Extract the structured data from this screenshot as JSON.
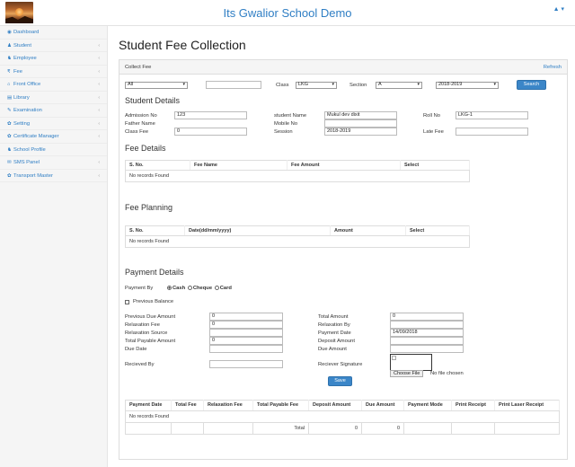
{
  "header": {
    "title": "Its Gwalior School Demo",
    "user_menu": "▲ ▾"
  },
  "sidebar": {
    "items": [
      {
        "label": "Dashboard",
        "icon": "dashboard-icon",
        "glyph": "◉",
        "has_sub": false
      },
      {
        "label": "Student",
        "icon": "user-icon",
        "glyph": "♟",
        "has_sub": true
      },
      {
        "label": "Employee",
        "icon": "users-icon",
        "glyph": "♞",
        "has_sub": true
      },
      {
        "label": "Fee",
        "icon": "rupee-icon",
        "glyph": "₹",
        "has_sub": true
      },
      {
        "label": "Front Office",
        "icon": "office-icon",
        "glyph": "⌂",
        "has_sub": true
      },
      {
        "label": "Library",
        "icon": "book-icon",
        "glyph": "▤",
        "has_sub": true
      },
      {
        "label": "Examination",
        "icon": "edit-icon",
        "glyph": "✎",
        "has_sub": true
      },
      {
        "label": "Setting",
        "icon": "gear-icon",
        "glyph": "✿",
        "has_sub": true
      },
      {
        "label": "Certificate Manager",
        "icon": "gear-icon",
        "glyph": "✿",
        "has_sub": true
      },
      {
        "label": "School Profile",
        "icon": "users-icon",
        "glyph": "♞",
        "has_sub": false
      },
      {
        "label": "SMS Panel",
        "icon": "mail-icon",
        "glyph": "✉",
        "has_sub": true
      },
      {
        "label": "Transport Master",
        "icon": "gear-icon",
        "glyph": "✿",
        "has_sub": true
      }
    ]
  },
  "page": {
    "title": "Student Fee Collection"
  },
  "panel": {
    "heading": "Collect Fee",
    "refresh": "Refresh"
  },
  "filters": {
    "type_value": "All",
    "search_value": "",
    "class_label": "Class",
    "class_value": "LKG",
    "section_label": "Section",
    "section_value": "A",
    "session_value": "2018-2019",
    "search_button": "Search"
  },
  "student_details": {
    "title": "Student Details",
    "admission_no_label": "Admission No",
    "admission_no": "123",
    "father_name_label": "Father Name",
    "class_fee_label": "Class Fee",
    "class_fee": "0",
    "student_name_label": "student Name",
    "student_name": "Mukul dev dixit",
    "mobile_no_label": "Mobile No",
    "mobile_no": "",
    "session_label": "Session",
    "session": "2018-2019",
    "roll_no_label": "Roll No",
    "roll_no": "LKG-1",
    "late_fee_label": "Late Fee",
    "late_fee": ""
  },
  "fee_details": {
    "title": "Fee Details",
    "columns": [
      "S. No.",
      "Fee Name",
      "Fee Amount",
      "Select"
    ],
    "empty": "No records Found"
  },
  "fee_planning": {
    "title": "Fee Planning",
    "columns": [
      "S. No.",
      "Date(dd/mm/yyyy)",
      "Amount",
      "Select"
    ],
    "empty": "No records Found"
  },
  "payment": {
    "title": "Payment Details",
    "payment_by_label": "Payment By",
    "options": [
      "Cash",
      "Cheque",
      "Card"
    ],
    "selected": "Cash",
    "previous_balance_label": "Previous Balance",
    "previous_due_amount_label": "Previous Due Amount",
    "previous_due_amount": "0",
    "relaxation_fee_label": "Relaxation Fee",
    "relaxation_fee": "0",
    "relaxation_source_label": "Relaxation Source",
    "relaxation_source": "",
    "total_payable_amount_label": "Total Payable Amount",
    "total_payable_amount": "0",
    "due_date_label": "Due Date",
    "due_date": "",
    "received_by_label": "Recieved By",
    "received_by": "",
    "total_amount_label": "Total Amount",
    "total_amount": "0",
    "relaxation_by_label": "Relaxation By",
    "relaxation_by": "",
    "payment_date_label": "Payment Date",
    "payment_date": "14/09/2018",
    "deposit_amount_label": "Deposit Amount",
    "deposit_amount": "",
    "due_amount_label": "Due Amount",
    "due_amount": "",
    "receiver_signature_label": "Reciever Signature",
    "choose_file": "Choose File",
    "no_file": "No file chosen",
    "save_button": "Save"
  },
  "history": {
    "columns": [
      "Payment Date",
      "Total Fee",
      "Relaxation Fee",
      "Total Payable Fee",
      "Deposit Amount",
      "Due Amount",
      "Payment Mode",
      "Print Receipt",
      "Print Laser Receipt"
    ],
    "empty": "No records Found",
    "total_label": "Total",
    "total_deposit": "0",
    "total_due": "0"
  }
}
